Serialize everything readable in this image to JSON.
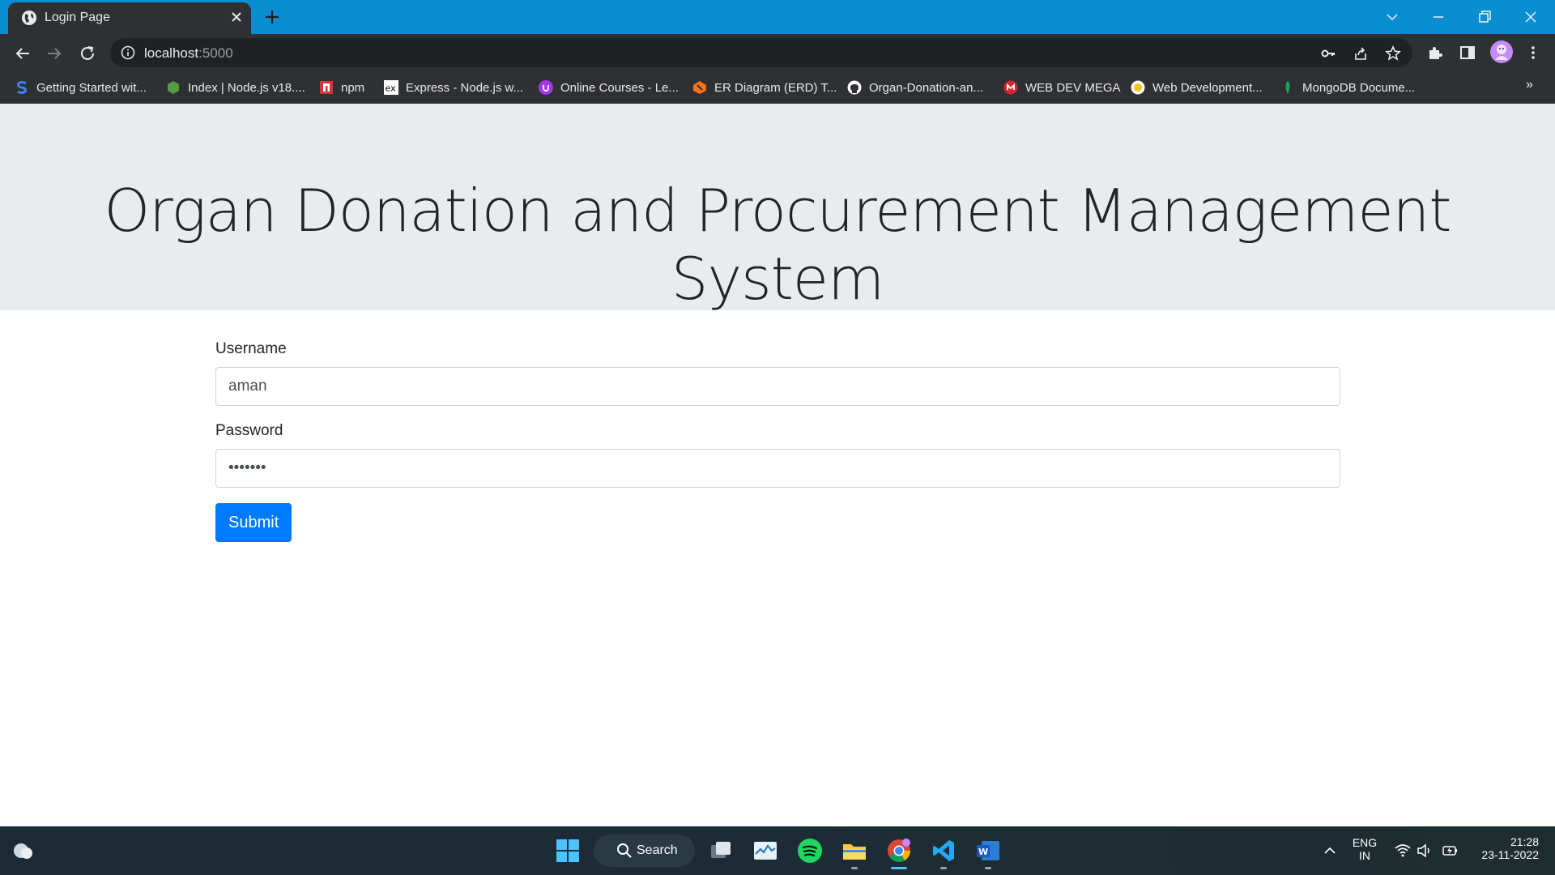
{
  "browser": {
    "tab_title": "Login Page",
    "url_host": "localhost",
    "url_port": ":5000",
    "bookmarks": [
      {
        "label": "Getting Started wit...",
        "icon": "s-logo-icon",
        "color": "#3b82f6"
      },
      {
        "label": "Index | Node.js v18....",
        "icon": "nodejs-icon",
        "color": "#539e43"
      },
      {
        "label": "npm",
        "icon": "npm-icon",
        "color": "#cb3837"
      },
      {
        "label": "Express - Node.js w...",
        "icon": "express-icon",
        "color": "#ffffff"
      },
      {
        "label": "Online Courses - Le...",
        "icon": "udemy-icon",
        "color": "#a435f0"
      },
      {
        "label": "ER Diagram (ERD) T...",
        "icon": "lucid-icon",
        "color": "#f97316"
      },
      {
        "label": "Organ-Donation-an...",
        "icon": "github-icon",
        "color": "#ffffff"
      },
      {
        "label": "WEB DEV MEGA",
        "icon": "mega-icon",
        "color": "#d9272e"
      },
      {
        "label": "Web Development...",
        "icon": "webdev-icon",
        "color": "#f5c518"
      },
      {
        "label": "MongoDB Docume...",
        "icon": "mongodb-icon",
        "color": "#13aa52"
      }
    ]
  },
  "page": {
    "title": "Organ Donation and Procurement Management System",
    "username_label": "Username",
    "username_value": "aman",
    "password_label": "Password",
    "password_value": "•••••••",
    "submit_label": "Submit"
  },
  "taskbar": {
    "search_label": "Search",
    "lang_line1": "ENG",
    "lang_line2": "IN",
    "time": "21:28",
    "date": "23-11-2022"
  },
  "colors": {
    "accent": "#007bff",
    "jumbotron_bg": "#e9ecef",
    "tabstrip_bg": "#0a8ed0"
  }
}
